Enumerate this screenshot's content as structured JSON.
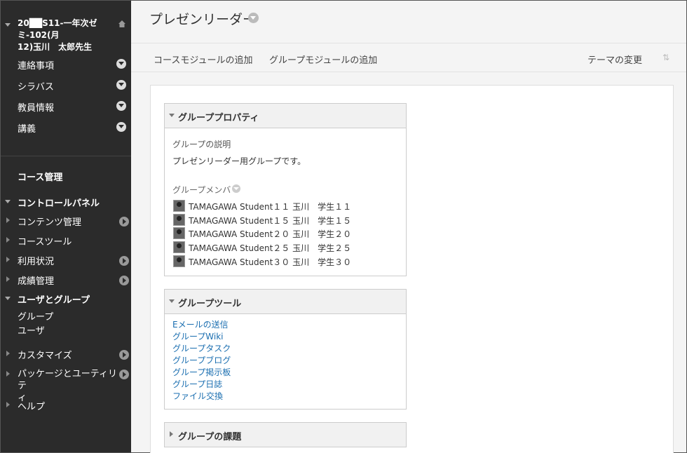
{
  "sidebar": {
    "course_title_line1": "20██S11-一年次ゼミ-102(月",
    "course_title_line2": "12)玉川　太郎先生",
    "menu": [
      {
        "label": "連絡事項"
      },
      {
        "label": "シラバス"
      },
      {
        "label": "教員情報"
      },
      {
        "label": "講義"
      }
    ],
    "course_management": "コース管理",
    "control_panel": "コントロールパネル",
    "panel_items": [
      {
        "label": "コンテンツ管理"
      },
      {
        "label": "コースツール"
      },
      {
        "label": "利用状況"
      },
      {
        "label": "成績管理"
      }
    ],
    "users_groups": "ユーザとグループ",
    "users_groups_sub": [
      "グループ",
      "ユーザ"
    ],
    "customize": "カスタマイズ",
    "packages_line1": "パッケージとユーティリテ",
    "packages_line2": "ィ",
    "help": "ヘルプ"
  },
  "header": {
    "title": "プレゼンリーダー"
  },
  "toolbar": {
    "add_course_module": "コースモジュールの追加",
    "add_group_module": "グループモジュールの追加",
    "change_theme": "テーマの変更"
  },
  "group_properties": {
    "title": "グループプロパティ",
    "description_label": "グループの説明",
    "description": "プレゼンリーダー用グループです。",
    "members_label": "グループメンバ",
    "members": [
      "TAMAGAWA Student１１ 玉川　学生１１",
      "TAMAGAWA Student１５ 玉川　学生１５",
      "TAMAGAWA Student２０ 玉川　学生２０",
      "TAMAGAWA Student２５ 玉川　学生２５",
      "TAMAGAWA Student３０ 玉川　学生３０"
    ]
  },
  "group_tools": {
    "title": "グループツール",
    "links": [
      "Eメールの送信",
      "グループWiki",
      "グループタスク",
      "グループブログ",
      "グループ掲示板",
      "グループ日誌",
      "ファイル交換"
    ]
  },
  "group_assignments": {
    "title": "グループの課題"
  },
  "colors": {
    "sidebar_bg": "#2b2b2b",
    "link": "#1a6eb0"
  }
}
